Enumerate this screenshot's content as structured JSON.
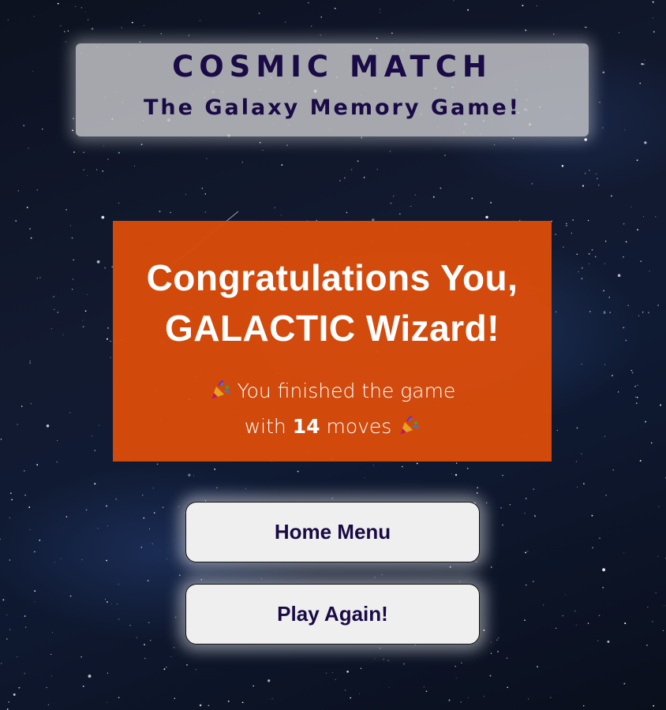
{
  "header": {
    "title": "COSMIC MATCH",
    "subtitle": "The Galaxy Memory Game!"
  },
  "win_modal": {
    "heading_line1": "Congratulations You,",
    "heading_line2": "GALACTIC Wizard!",
    "message_prefix": "You finished the game",
    "message_with": "with",
    "moves_count": "14",
    "message_suffix": "moves",
    "icon": "party-popper-icon"
  },
  "buttons": {
    "home_label": "Home Menu",
    "play_again_label": "Play Again!"
  },
  "colors": {
    "title_text": "#1a0a45",
    "modal_background": "#da4c0a",
    "button_background": "#efefef"
  }
}
